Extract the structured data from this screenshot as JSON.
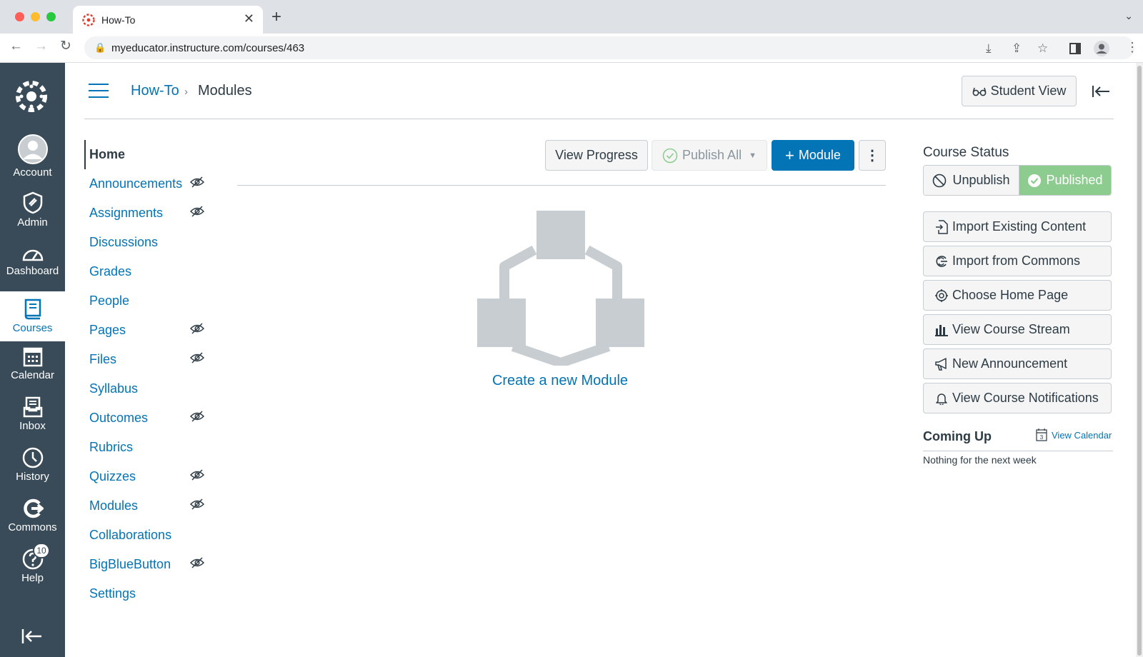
{
  "browser": {
    "tab_title": "How-To",
    "url": "myeducator.instructure.com/courses/463"
  },
  "global_nav": {
    "items": [
      {
        "label": "Account",
        "icon": "avatar-icon"
      },
      {
        "label": "Admin",
        "icon": "shield-icon"
      },
      {
        "label": "Dashboard",
        "icon": "speedometer-icon"
      },
      {
        "label": "Courses",
        "icon": "book-icon"
      },
      {
        "label": "Calendar",
        "icon": "calendar-icon"
      },
      {
        "label": "Inbox",
        "icon": "inbox-icon"
      },
      {
        "label": "History",
        "icon": "clock-icon"
      },
      {
        "label": "Commons",
        "icon": "commons-icon"
      },
      {
        "label": "Help",
        "icon": "help-icon",
        "badge": "10"
      }
    ],
    "active": "Courses"
  },
  "header": {
    "breadcrumb_course": "How-To",
    "breadcrumb_separator": "›",
    "breadcrumb_current": "Modules",
    "student_view_label": "Student View"
  },
  "course_nav": {
    "items": [
      {
        "label": "Home",
        "hidden": false,
        "active": true
      },
      {
        "label": "Announcements",
        "hidden": true
      },
      {
        "label": "Assignments",
        "hidden": true
      },
      {
        "label": "Discussions",
        "hidden": false
      },
      {
        "label": "Grades",
        "hidden": false
      },
      {
        "label": "People",
        "hidden": false
      },
      {
        "label": "Pages",
        "hidden": true
      },
      {
        "label": "Files",
        "hidden": true
      },
      {
        "label": "Syllabus",
        "hidden": false
      },
      {
        "label": "Outcomes",
        "hidden": true
      },
      {
        "label": "Rubrics",
        "hidden": false
      },
      {
        "label": "Quizzes",
        "hidden": true
      },
      {
        "label": "Modules",
        "hidden": true
      },
      {
        "label": "Collaborations",
        "hidden": false
      },
      {
        "label": "BigBlueButton",
        "hidden": true
      },
      {
        "label": "Settings",
        "hidden": false
      }
    ]
  },
  "modules_toolbar": {
    "view_progress_label": "View Progress",
    "publish_all_label": "Publish All",
    "add_module_label": "Module"
  },
  "empty_state": {
    "create_label": "Create a new Module"
  },
  "sidebar": {
    "course_status_title": "Course Status",
    "unpublish_label": "Unpublish",
    "published_label": "Published",
    "actions": [
      {
        "label": "Import Existing Content",
        "icon": "import-icon"
      },
      {
        "label": "Import from Commons",
        "icon": "commons-icon"
      },
      {
        "label": "Choose Home Page",
        "icon": "target-icon"
      },
      {
        "label": "View Course Stream",
        "icon": "bar-chart-icon"
      },
      {
        "label": "New Announcement",
        "icon": "megaphone-icon"
      },
      {
        "label": "View Course Notifications",
        "icon": "bell-icon"
      }
    ],
    "coming_up_title": "Coming Up",
    "view_calendar_label": "View Calendar",
    "calendar_day": "3",
    "coming_up_empty": "Nothing for the next week"
  },
  "colors": {
    "nav_bg": "#394b58",
    "brand_blue": "#0374b5",
    "published_green": "#8dcc8f",
    "logo_red": "#e03e2d"
  }
}
